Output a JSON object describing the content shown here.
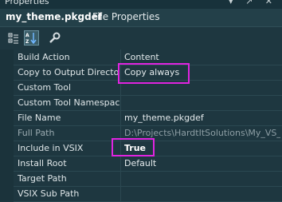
{
  "window": {
    "title": "Properties",
    "controls": "▾ ↗ ✕"
  },
  "object_selector": {
    "name": "my_theme.pkgdef",
    "type": "File Properties"
  },
  "toolbar": {
    "buttons": [
      {
        "icon": "categorized-icon",
        "active": false
      },
      {
        "icon": "alphabetical-sort-icon",
        "active": true
      },
      {
        "icon": "property-pages-wrench-icon",
        "active": false
      }
    ]
  },
  "properties": [
    {
      "label": "Build Action",
      "value": "Content"
    },
    {
      "label": "Copy to Output Directory",
      "value": "Copy always",
      "highlighted": true
    },
    {
      "label": "Custom Tool",
      "value": ""
    },
    {
      "label": "Custom Tool Namespace",
      "value": ""
    },
    {
      "label": "File Name",
      "value": "my_theme.pkgdef"
    },
    {
      "label": "Full Path",
      "value": "D:\\Projects\\HardtItSolutions\\My_VS_",
      "dim": true
    },
    {
      "label": "Include in VSIX",
      "value": "True",
      "bold": true,
      "highlighted": true
    },
    {
      "label": "Install Root",
      "value": "Default"
    },
    {
      "label": "Target Path",
      "value": ""
    },
    {
      "label": "VSIX Sub Path",
      "value": ""
    }
  ],
  "colors": {
    "highlight_box": "#e024e0",
    "background": "#1e3740"
  }
}
